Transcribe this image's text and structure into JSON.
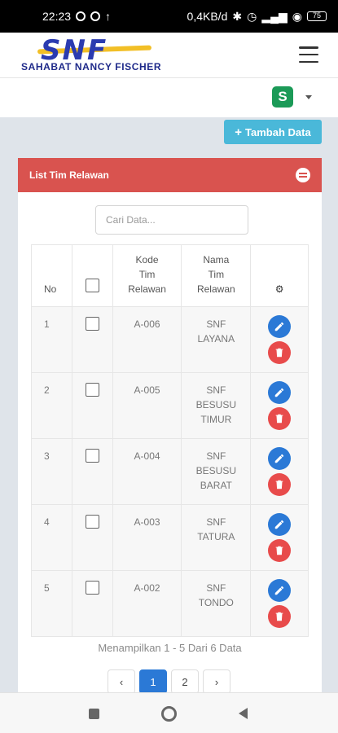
{
  "status_bar": {
    "time": "22:23",
    "network_speed": "0,4KB/d",
    "battery": "75"
  },
  "header": {
    "logo_letters": "SNF",
    "logo_tagline": "SAHABAT NANCY FISCHER"
  },
  "subheader": {
    "app_icon_letter": "S"
  },
  "toolbar": {
    "add_label": "Tambah Data",
    "add_icon": "+"
  },
  "panel": {
    "title": "List Tim Relawan",
    "search_placeholder": "Cari Data..."
  },
  "table": {
    "columns": {
      "no": "No",
      "kode": [
        "Kode",
        "Tim",
        "Relawan"
      ],
      "nama": [
        "Nama",
        "Tim",
        "Relawan"
      ],
      "actions_icon": "⚙"
    },
    "rows": [
      {
        "no": "1",
        "kode": "A-006",
        "nama": [
          "SNF",
          "LAYANA"
        ]
      },
      {
        "no": "2",
        "kode": "A-005",
        "nama": [
          "SNF",
          "BESUSU",
          "TIMUR"
        ]
      },
      {
        "no": "3",
        "kode": "A-004",
        "nama": [
          "SNF",
          "BESUSU",
          "BARAT"
        ]
      },
      {
        "no": "4",
        "kode": "A-003",
        "nama": [
          "SNF",
          "TATURA"
        ]
      },
      {
        "no": "5",
        "kode": "A-002",
        "nama": [
          "SNF",
          "TONDO"
        ]
      }
    ]
  },
  "footer_info": "Menampilkan 1 - 5 Dari 6 Data",
  "pagination": {
    "prev": "‹",
    "pages": [
      "1",
      "2"
    ],
    "next": "›",
    "current_page": "1"
  },
  "colors": {
    "panel_header": "#d9534f",
    "add_button": "#4ab8d9",
    "edit_button": "#2b79d6",
    "delete_button": "#e84b4b"
  }
}
